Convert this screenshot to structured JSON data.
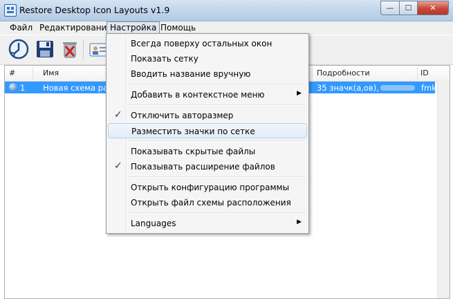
{
  "window": {
    "title": "Restore Desktop Icon Layouts v1.9",
    "controls": {
      "minimize": "—",
      "maximize": "☐",
      "close": "✕"
    }
  },
  "menubar": [
    {
      "label": "Файл"
    },
    {
      "label": "Редактирование"
    },
    {
      "label": "Настройка"
    },
    {
      "label": "Помощь"
    }
  ],
  "toolbar": {
    "icons": [
      "restore-icon",
      "save-icon",
      "delete-icon",
      "contact-card-icon"
    ]
  },
  "list": {
    "columns": [
      {
        "label": "#"
      },
      {
        "label": "Имя"
      },
      {
        "label": "Подробности"
      },
      {
        "label": "ID"
      }
    ],
    "rows": [
      {
        "num": "1",
        "name": "Новая схема распо",
        "details": "35 значк(а,ов),",
        "id": "fmk"
      }
    ]
  },
  "dropdown": {
    "items": [
      {
        "label": "Всегда поверху остальных окон",
        "checked": false,
        "submenu": false
      },
      {
        "label": "Показать сетку",
        "checked": false,
        "submenu": false
      },
      {
        "label": "Вводить название вручную",
        "checked": false,
        "submenu": false
      },
      {
        "label": "Добавить в контекстное меню",
        "checked": false,
        "submenu": true
      },
      {
        "label": "Отключить авторазмер",
        "checked": true,
        "submenu": false
      },
      {
        "label": "Разместить значки по сетке",
        "checked": false,
        "submenu": false,
        "hovered": true
      },
      {
        "label": "Показывать скрытые файлы",
        "checked": false,
        "submenu": false
      },
      {
        "label": "Показывать расширение файлов",
        "checked": true,
        "submenu": false
      },
      {
        "label": "Открыть конфигурацию программы",
        "checked": false,
        "submenu": false
      },
      {
        "label": "Открыть файл схемы расположения",
        "checked": false,
        "submenu": false
      },
      {
        "label": "Languages",
        "checked": false,
        "submenu": true
      }
    ],
    "check_glyph": "✓",
    "submenu_glyph": "▶"
  },
  "colors": {
    "selection": "#3399ff",
    "menu_bg": "#f5f5f5",
    "titlebar": "#c4d7ec"
  }
}
